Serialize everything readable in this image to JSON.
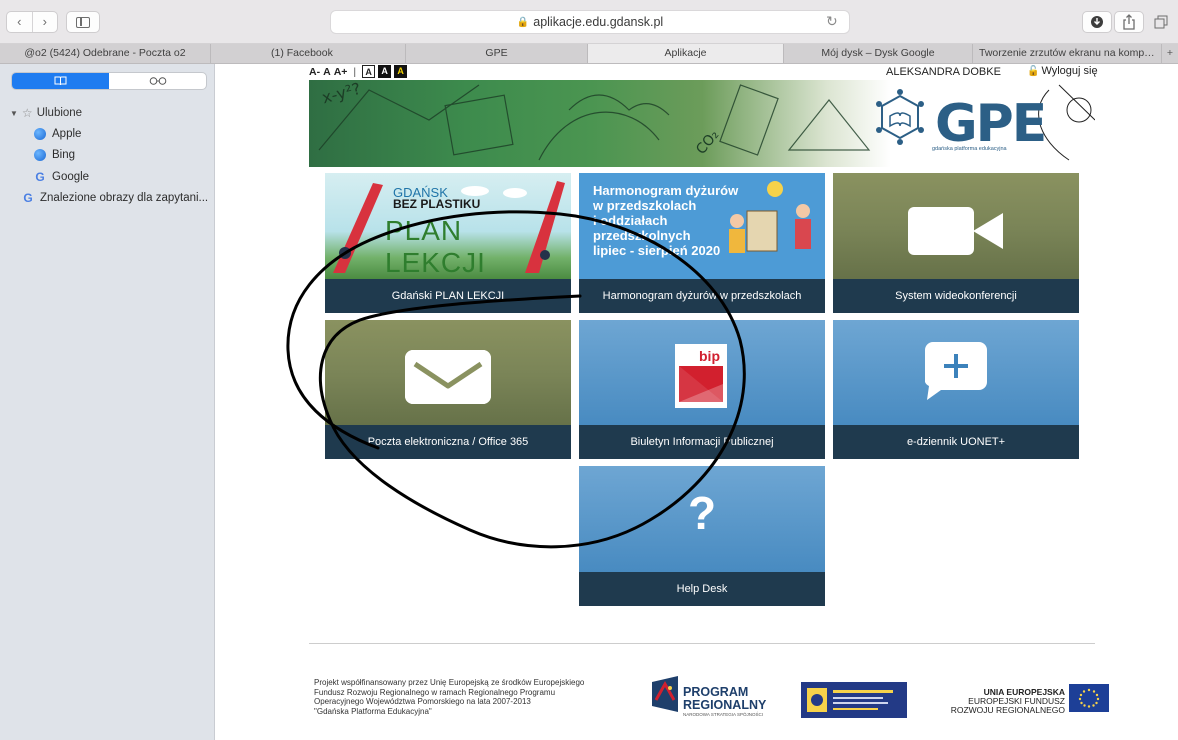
{
  "browser": {
    "nav_back": "‹",
    "nav_forward": "›",
    "address": "aplikacje.edu.gdansk.pl",
    "reload": "↻",
    "tabs": [
      "@o2 (5424) Odebrane - Poczta o2",
      "(1) Facebook",
      "GPE",
      "Aplikacje",
      "Mój dysk – Dysk Google",
      "Tworzenie zrzutów ekranu na komput..."
    ],
    "active_tab": "Aplikacje",
    "new_tab": "+"
  },
  "sidebar": {
    "favorites_label": "Ulubione",
    "items": [
      "Apple",
      "Bing",
      "Google"
    ],
    "extra_item": "Znalezione obrazy dla zapytani..."
  },
  "page": {
    "font_sizes": [
      "A-",
      "A",
      "A+"
    ],
    "contrast_letter": "A",
    "user_name": "ALEKSANDRA DOBKE",
    "logout": "Wyloguj się",
    "gpe_logo": "GPE",
    "gpe_subtitle": "gdańska platforma edukacyjna",
    "tiles": {
      "plan": {
        "label": "Gdański PLAN LEKCJI",
        "img_title": "GDAŃSK",
        "img_sub": "BEZ PLASTIKU",
        "img_main": "PLAN LEKCJI"
      },
      "harmonogram": {
        "label": "Harmonogram dyżurów w przedszkolach",
        "img_lines": [
          "Harmonogram dyżurów",
          "w przedszkolach",
          "i oddziałach",
          "przedszkolnych",
          "lipiec - sierpień 2020"
        ]
      },
      "video": {
        "label": "System wideokonferencji"
      },
      "poczta": {
        "label": "Poczta elektroniczna / Office 365"
      },
      "bip": {
        "label": "Biuletyn Informacji Publicznej",
        "icon_text": "bip"
      },
      "dziennik": {
        "label": "e-dziennik UONET+"
      },
      "help": {
        "label": "Help Desk",
        "icon_text": "?"
      }
    },
    "footer": {
      "text": "Projekt współfinansowany przez Unię Europejską ze środków Europejskiego\nFundusz Rozwoju Regionalnego w ramach Regionalnego Programu\nOperacyjnego Województwa Pomorskiego na lata 2007-2013\n\"Gdańska Platforma Edukacyjna\"",
      "program_1": "PROGRAM",
      "program_2": "REGIONALNY",
      "program_sub": "NARODOWA STRATEGIA SPÓJNOŚCI",
      "ue_1": "UNIA EUROPEJSKA",
      "ue_2": "EUROPEJSKI FUNDUSZ",
      "ue_3": "ROZWOJU REGIONALNEGO"
    }
  },
  "colors": {
    "active_segment": "#1f7cf0",
    "tile_label_bg": "#1f3a4e",
    "olive": "#7a8457",
    "blue": "#3c82bb",
    "annotation": "#000000"
  }
}
